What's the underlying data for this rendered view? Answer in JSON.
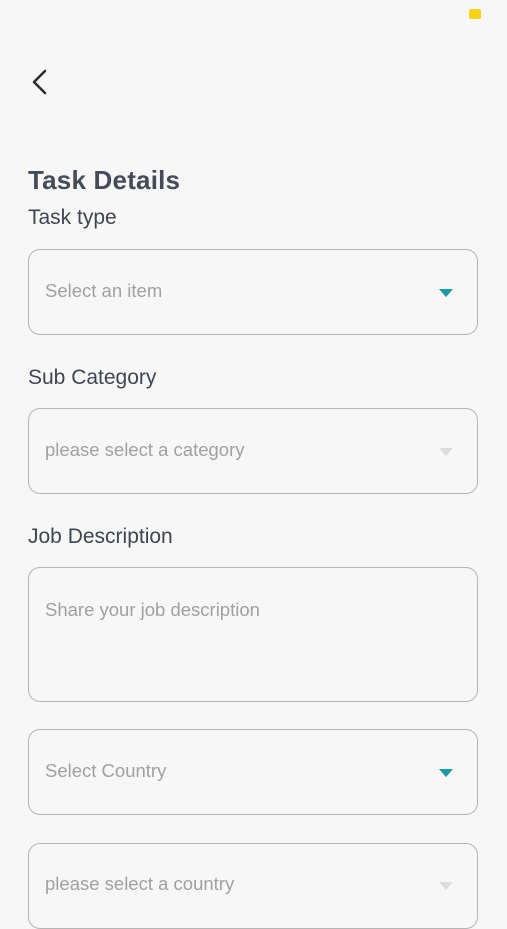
{
  "header": {
    "back_icon": "chevron-left-icon"
  },
  "page": {
    "title": "Task Details"
  },
  "task_type": {
    "label": "Task type",
    "placeholder": "Select an item"
  },
  "sub_category": {
    "label": "Sub Category",
    "placeholder": "please select a category"
  },
  "job_description": {
    "label": "Job Description",
    "placeholder": "Share your job description"
  },
  "country": {
    "placeholder": "Select Country"
  },
  "city": {
    "placeholder": "please select a country"
  },
  "colors": {
    "accent": "#1c98a6",
    "text": "#454b57",
    "border": "#b5b5b5",
    "placeholder": "#a0a0a0",
    "background": "#f7f7f7"
  }
}
